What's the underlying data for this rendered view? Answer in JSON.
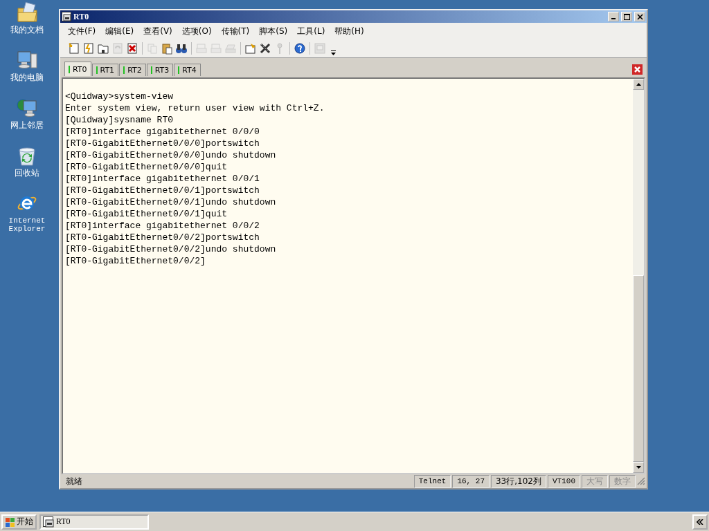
{
  "desktop_icons": [
    {
      "kind": "documents",
      "label": "我的文档"
    },
    {
      "kind": "computer",
      "label": "我的电脑"
    },
    {
      "kind": "network",
      "label": "网上邻居"
    },
    {
      "kind": "recycle",
      "label": "回收站"
    },
    {
      "kind": "browser",
      "label": "Internet Explorer"
    }
  ],
  "window": {
    "title": "RT0",
    "menu": [
      "文件(F)",
      "编辑(E)",
      "查看(V)",
      "选项(O)",
      "传输(T)",
      "脚本(S)",
      "工具(L)",
      "帮助(H)"
    ],
    "toolbar": [
      [
        {
          "kind": "new",
          "disabled": false
        },
        {
          "kind": "quick",
          "disabled": false
        },
        {
          "kind": "folder",
          "disabled": false
        },
        {
          "kind": "reconnect",
          "disabled": true
        },
        {
          "kind": "disconnect",
          "disabled": false
        }
      ],
      [
        {
          "kind": "copy",
          "disabled": true
        },
        {
          "kind": "paste",
          "disabled": false
        },
        {
          "kind": "find",
          "disabled": false
        }
      ],
      [
        {
          "kind": "print",
          "disabled": true
        },
        {
          "kind": "print",
          "disabled": true
        },
        {
          "kind": "printer",
          "disabled": true
        }
      ],
      [
        {
          "kind": "options",
          "disabled": false
        },
        {
          "kind": "tools",
          "disabled": false
        },
        {
          "kind": "key",
          "disabled": true
        }
      ],
      [
        {
          "kind": "help",
          "disabled": false
        }
      ],
      [
        {
          "kind": "monitor",
          "disabled": true
        }
      ]
    ],
    "tabs": [
      {
        "label": "RT0",
        "selected": true
      },
      {
        "label": "RT1",
        "selected": false
      },
      {
        "label": "RT2",
        "selected": false
      },
      {
        "label": "RT3",
        "selected": false
      },
      {
        "label": "RT4",
        "selected": false
      }
    ],
    "terminal_lines": [
      "<Quidway>system-view",
      "Enter system view, return user view with Ctrl+Z.",
      "[Quidway]sysname RT0",
      "[RT0]interface gigabitethernet 0/0/0",
      "[RT0-GigabitEthernet0/0/0]portswitch",
      "[RT0-GigabitEthernet0/0/0]undo shutdown",
      "[RT0-GigabitEthernet0/0/0]quit",
      "[RT0]interface gigabitethernet 0/0/1",
      "[RT0-GigabitEthernet0/0/1]portswitch",
      "[RT0-GigabitEthernet0/0/1]undo shutdown",
      "[RT0-GigabitEthernet0/0/1]quit",
      "[RT0]interface gigabitethernet 0/0/2",
      "[RT0-GigabitEthernet0/0/2]portswitch",
      "[RT0-GigabitEthernet0/0/2]undo shutdown",
      "[RT0-GigabitEthernet0/0/2]"
    ],
    "status_bar": {
      "message": "就绪",
      "protocol": "Telnet",
      "cursor": "16,  27",
      "size": "33行,102列",
      "emulation": "VT100",
      "indicators": [
        {
          "label": "大写",
          "disabled": true
        },
        {
          "label": "数字",
          "disabled": true
        }
      ]
    }
  },
  "taskbar": {
    "start": "开始",
    "tasks": [
      {
        "label": "RT0",
        "selected": true
      }
    ]
  }
}
